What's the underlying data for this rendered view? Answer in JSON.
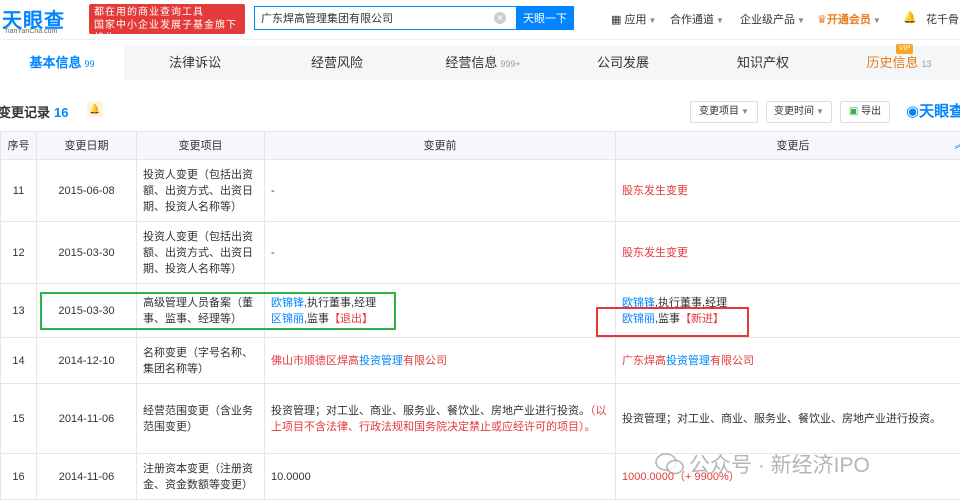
{
  "header": {
    "logo_text": "天眼查",
    "logo_sub": "TianYanCha.com",
    "slogan_line1": "都在用的商业查询工具",
    "slogan_line2": "国家中小企业发展子基金旗下机构",
    "search_value": "广东焊高管理集团有限公司",
    "search_button": "天眼一下",
    "nav_app": "应用",
    "nav_partner": "合作通道",
    "nav_enterprise": "企业级产品",
    "nav_vip": "开通会员",
    "user_name": "花千骨"
  },
  "tabs": [
    {
      "label": "基本信息",
      "count": "99"
    },
    {
      "label": "法律诉讼",
      "count": ""
    },
    {
      "label": "经营风险",
      "count": ""
    },
    {
      "label": "经营信息",
      "count": "999+"
    },
    {
      "label": "公司发展",
      "count": ""
    },
    {
      "label": "知识产权",
      "count": ""
    },
    {
      "label": "历史信息",
      "count": "13"
    }
  ],
  "vip_badge": "VIP",
  "section": {
    "title": "变更记录",
    "count": "16",
    "filter_item": "变更项目",
    "filter_time": "变更时间",
    "export": "导出",
    "brand": "天眼查"
  },
  "table": {
    "headers": [
      "序号",
      "变更日期",
      "变更项目",
      "变更前",
      "变更后"
    ],
    "rows": [
      {
        "no": "11",
        "date": "2015-06-08",
        "item": "投资人变更（包括出资额、出资方式、出资日期、投资人名称等）",
        "before": "-",
        "after": "股东发生变更"
      },
      {
        "no": "12",
        "date": "2015-03-30",
        "item": "投资人变更（包括出资额、出资方式、出资日期、投资人名称等）",
        "before": "-",
        "after": "股东发生变更"
      },
      {
        "no": "13",
        "date": "2015-03-30",
        "item": "高级管理人员备案（董事、监事、经理等）",
        "before_l1_name": "欧锦锋",
        "before_l1_role": ",执行董事,经理",
        "before_l2_name": "区锦丽",
        "before_l2_role": ",监事",
        "before_l2_tag": "【退出】",
        "after_l1_name": "欧锦锋",
        "after_l1_role": ",执行董事,经理",
        "after_l2_name": "欧锦丽",
        "after_l2_role": ",监事",
        "after_l2_tag": "【新进】"
      },
      {
        "no": "14",
        "date": "2014-12-10",
        "item": "名称变更（字号名称、集团名称等）",
        "before_a": "佛山市顺德区焊高",
        "before_b": "投资管理",
        "before_c": "有限公司",
        "after_a": "广东焊高",
        "after_b": "投资管理",
        "after_c": "有限公司"
      },
      {
        "no": "15",
        "date": "2014-11-06",
        "item": "经营范围变更（含业务范围变更）",
        "before_main": "投资管理；对工业、商业、服务业、餐饮业、房地产业进行投资。",
        "before_note": "（以上项目不含法律、行政法规和国务院决定禁止或应经许可的项目）。",
        "after": "投资管理；对工业、商业、服务业、餐饮业、房地产业进行投资。"
      },
      {
        "no": "16",
        "date": "2014-11-06",
        "item": "注册资本变更（注册资金、资金数额等变更）",
        "before": "10.0000",
        "after_value": "1000.0000",
        "after_pct": "（+ 9900%）"
      }
    ]
  },
  "watermark": "公众号 · 新经济IPO"
}
